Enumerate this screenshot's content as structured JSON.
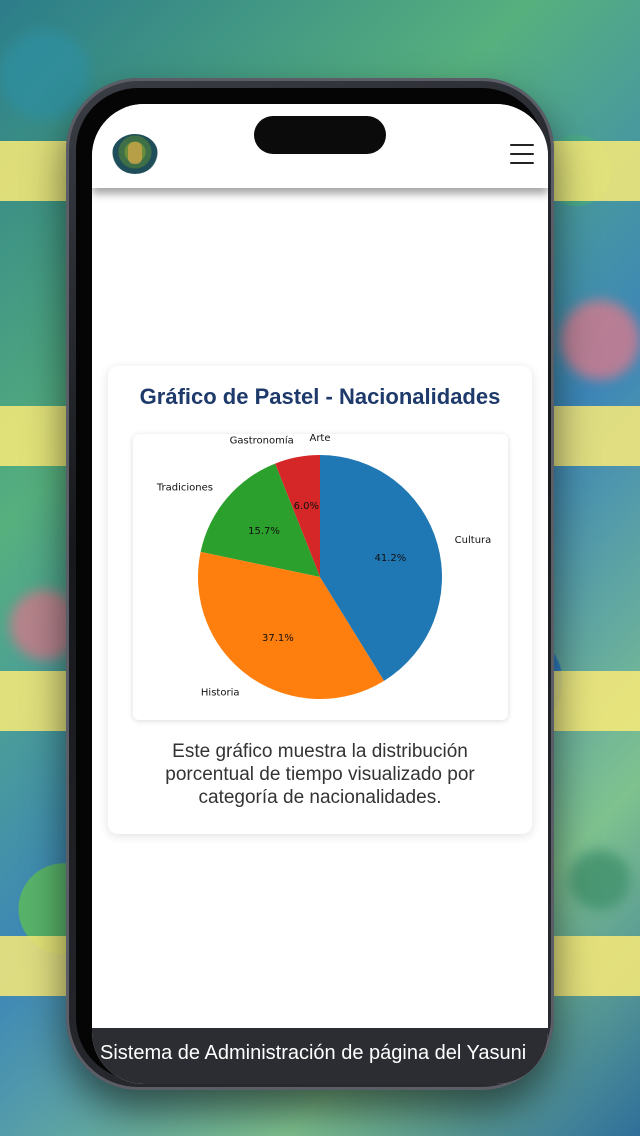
{
  "header": {
    "logo_icon": "yasuni-logo-icon",
    "menu_icon": "hamburger-menu-icon"
  },
  "card": {
    "title": "Gráfico de Pastel - Nacionalidades",
    "description": "Este gráfico muestra la distribución porcentual de tiempo visualizado por categoría de nacionalidades."
  },
  "chart_data": {
    "type": "pie",
    "title": "",
    "start_angle": "90 (top)",
    "direction": "counterclockwise",
    "slices": [
      {
        "label": "Arte",
        "value": 0.0,
        "pct_label": "0.0%",
        "color": "#9467bd"
      },
      {
        "label": "Gastronomía",
        "value": 6.0,
        "pct_label": "6.0%",
        "color": "#d62728"
      },
      {
        "label": "Tradiciones",
        "value": 15.7,
        "pct_label": "15.7%",
        "color": "#2ca02c"
      },
      {
        "label": "Historia",
        "value": 37.1,
        "pct_label": "37.1%",
        "color": "#ff7f0e"
      },
      {
        "label": "Cultura",
        "value": 41.2,
        "pct_label": "41.2%",
        "color": "#1f77b4"
      }
    ]
  },
  "footer": {
    "text": "Sistema de Administración de página del Yasuni"
  },
  "colors": {
    "title": "#1e3a6b",
    "footer_bg": "#2b2d33"
  }
}
